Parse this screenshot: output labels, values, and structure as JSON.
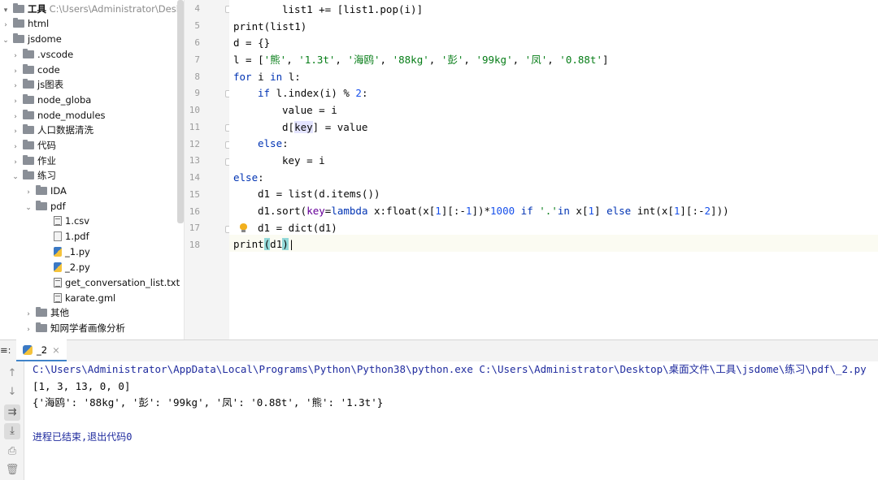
{
  "project": {
    "root_name": "工具",
    "root_path": "C:\\Users\\Administrator\\Desktop\\",
    "items": [
      {
        "label": "html"
      },
      {
        "label": "jsdome"
      },
      {
        "label": ".vscode"
      },
      {
        "label": "code"
      },
      {
        "label": "js图表"
      },
      {
        "label": "node_globa"
      },
      {
        "label": "node_modules"
      },
      {
        "label": "人口数据清洗"
      },
      {
        "label": "代码"
      },
      {
        "label": "作业"
      },
      {
        "label": "练习"
      },
      {
        "label": "IDA"
      },
      {
        "label": "pdf"
      },
      {
        "label": "1.csv"
      },
      {
        "label": "1.pdf"
      },
      {
        "label": "_1.py"
      },
      {
        "label": "_2.py"
      },
      {
        "label": "get_conversation_list.txt"
      },
      {
        "label": "karate.gml"
      },
      {
        "label": "其他"
      },
      {
        "label": "知网学者画像分析"
      }
    ]
  },
  "editor": {
    "line_numbers": [
      "4",
      "5",
      "6",
      "7",
      "8",
      "9",
      "10",
      "11",
      "12",
      "13",
      "14",
      "15",
      "16",
      "17",
      "18"
    ]
  },
  "run": {
    "panel_label": "≡:",
    "tab_label": "_2",
    "tab_close": "×",
    "command": "C:\\Users\\Administrator\\AppData\\Local\\Programs\\Python\\Python38\\python.exe C:\\Users\\Administrator\\Desktop\\桌面文件\\工具\\jsdome\\练习\\pdf\\_2.py",
    "output_line1": "[1, 3, 13, 0, 0]",
    "output_line2": "{'海鸥': '88kg', '彭': '99kg', '凤': '0.88t', '熊': '1.3t'}",
    "exit_message": "进程已结束,退出代码0"
  },
  "colors": {
    "keyword": "#0033b3",
    "string": "#067d17",
    "number": "#1750eb",
    "console_path": "#1f2b9e"
  }
}
